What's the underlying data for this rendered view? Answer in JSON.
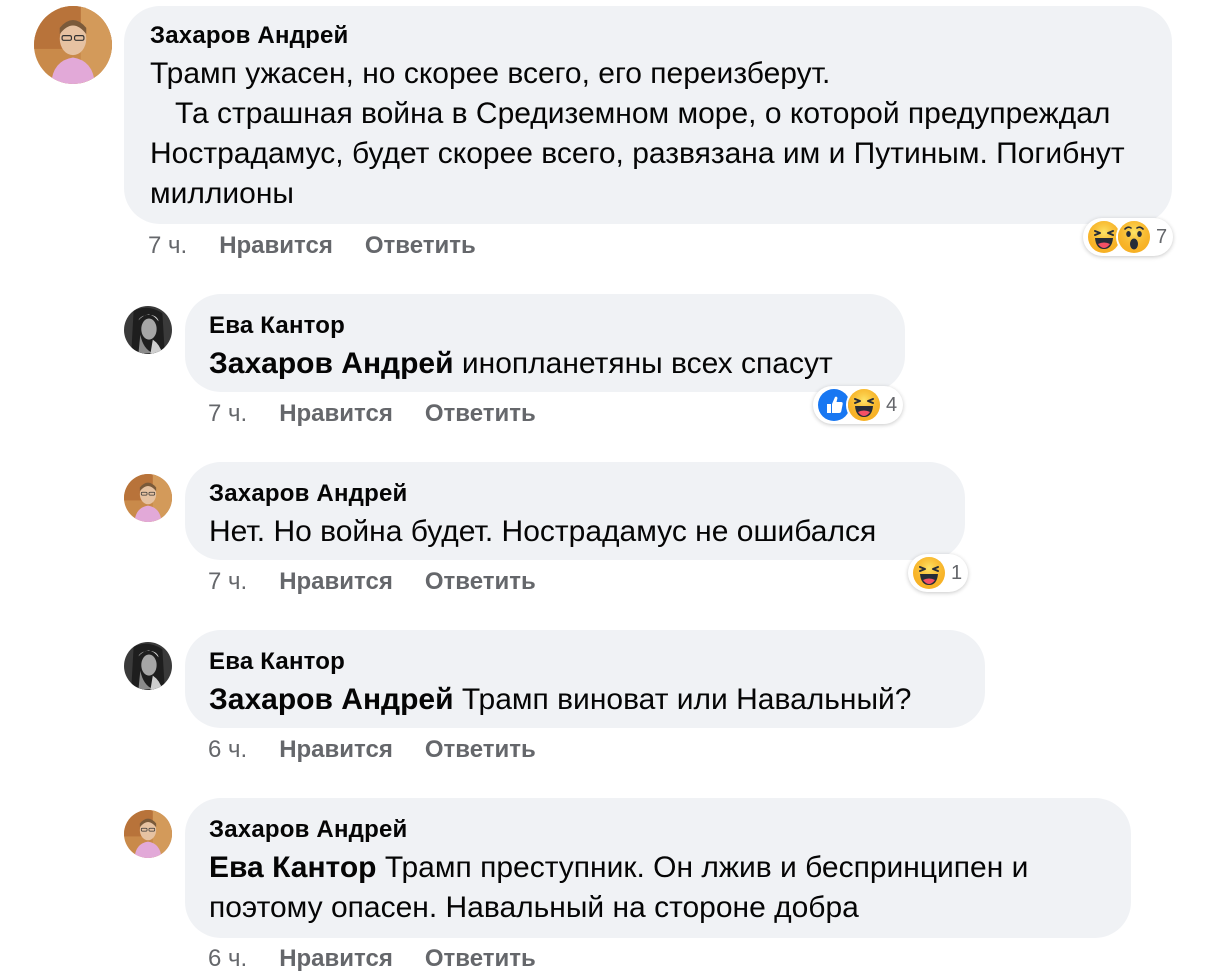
{
  "colors": {
    "bubble_bg": "#f0f2f5",
    "meta_text": "#65676b",
    "like_blue": "#1877f2",
    "emoji_yellow": "#f7b125"
  },
  "comments": [
    {
      "author": "Захаров Андрей",
      "mention": "",
      "text": "Трамп ужасен, но скорее всего, его переизберут.\n   Та страшная война в Средиземном море, о которой предупреждал Нострадамус, будет скорее всего, развязана им и Путиным. Погибнут миллионы",
      "time": "7 ч.",
      "like_label": "Нравится",
      "reply_label": "Ответить",
      "reaction_icons": [
        "haha-icon",
        "wow-icon"
      ],
      "reaction_count": "7"
    },
    {
      "author": "Ева Кантор",
      "mention": "Захаров Андрей",
      "text": "инопланетяны всех спасут",
      "time": "7 ч.",
      "like_label": "Нравится",
      "reply_label": "Ответить",
      "reaction_icons": [
        "like-icon",
        "haha-icon"
      ],
      "reaction_count": "4"
    },
    {
      "author": "Захаров Андрей",
      "mention": "",
      "text": "Нет. Но война будет. Нострадамус не ошибался",
      "time": "7 ч.",
      "like_label": "Нравится",
      "reply_label": "Ответить",
      "reaction_icons": [
        "haha-icon"
      ],
      "reaction_count": "1"
    },
    {
      "author": "Ева Кантор",
      "mention": "Захаров Андрей",
      "text": "Трамп виноват или Навальный?",
      "time": "6 ч.",
      "like_label": "Нравится",
      "reply_label": "Ответить",
      "reaction_icons": [],
      "reaction_count": ""
    },
    {
      "author": "Захаров Андрей",
      "mention": "Ева Кантор",
      "text": "Трамп преступник. Он лжив и беспринципен и поэтому опасен. Навальный на стороне добра",
      "time": "6 ч.",
      "like_label": "Нравится",
      "reply_label": "Ответить",
      "reaction_icons": [],
      "reaction_count": ""
    }
  ]
}
